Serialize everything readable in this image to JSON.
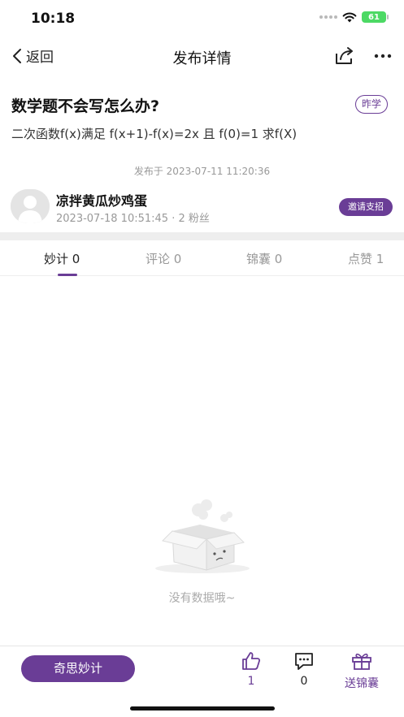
{
  "status": {
    "time": "10:18",
    "battery": "61"
  },
  "nav": {
    "back_label": "返回",
    "title": "发布详情"
  },
  "post": {
    "title": "数学题不会写怎么办?",
    "tag": "昨学",
    "body": "二次函数f(x)满足 f(x+1)-f(x)=2x 且 f(0)=1 求f(X)",
    "publish_time": "发布于 2023-07-11 11:20:36"
  },
  "author": {
    "name": "凉拌黄瓜炒鸡蛋",
    "meta": "2023-07-18 10:51:45 · 2 粉丝",
    "invite_label": "邀请支招"
  },
  "tabs": [
    {
      "label": "妙计 0"
    },
    {
      "label": "评论 0"
    },
    {
      "label": "锦囊 0"
    },
    {
      "label": "点赞 1"
    }
  ],
  "empty": {
    "text": "没有数据哦~"
  },
  "bottom": {
    "primary_label": "奇思妙计",
    "like_count": "1",
    "comment_count": "0",
    "gift_label": "送锦囊"
  },
  "colors": {
    "accent": "#6a3d96",
    "divider": "#eeeeee",
    "muted": "#999999"
  }
}
